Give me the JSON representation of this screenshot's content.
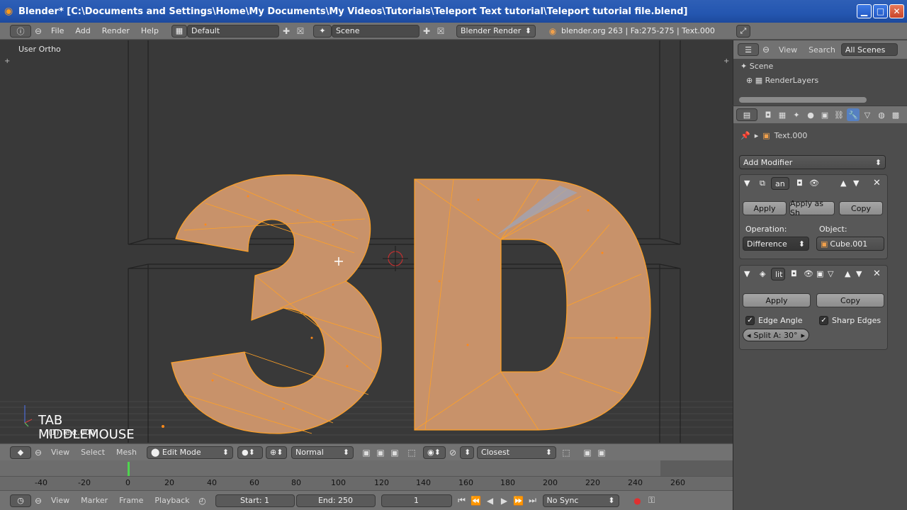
{
  "window": {
    "title": "Blender* [C:\\Documents and Settings\\Home\\My Documents\\My Videos\\Tutorials\\Teleport Text tutorial\\Teleport tutorial file.blend]",
    "minimize": "▁",
    "maximize": "□",
    "close": "✕"
  },
  "menubar": {
    "menus": [
      "File",
      "Add",
      "Render",
      "Help"
    ],
    "layout": "Default",
    "scene": "Scene",
    "engine": "Blender Render",
    "stats": "blender.org 263 | Fa:275-275 | Text.000"
  },
  "viewport": {
    "view_label": "User Ortho",
    "overlay_line1": "TAB",
    "overlay_line2": "MIDDLEMOUSE",
    "object_label": "(1) Text.000"
  },
  "header3d": {
    "menus": [
      "View",
      "Select",
      "Mesh"
    ],
    "mode": "Edit Mode",
    "orientation": "Normal",
    "snap": "Closest"
  },
  "timeline": {
    "ticks": [
      "-40",
      "-20",
      "0",
      "20",
      "40",
      "60",
      "80",
      "100",
      "120",
      "140",
      "160",
      "180",
      "200",
      "220",
      "240",
      "260"
    ]
  },
  "bottombar": {
    "menus": [
      "View",
      "Marker",
      "Frame",
      "Playback"
    ],
    "start": "Start: 1",
    "end": "End: 250",
    "current": "1",
    "sync": "No Sync"
  },
  "outliner": {
    "menus": [
      "View",
      "Search"
    ],
    "filter": "All Scenes",
    "items": [
      "Scene",
      "RenderLayers"
    ]
  },
  "properties": {
    "object": "Text.000",
    "add_modifier": "Add Modifier",
    "mod1": {
      "name": "an",
      "apply": "Apply",
      "apply_shape": "Apply as Sh",
      "copy": "Copy",
      "operation_label": "Operation:",
      "operation": "Difference",
      "object_label": "Object:",
      "object": "Cube.001"
    },
    "mod2": {
      "name": "lit",
      "apply": "Apply",
      "copy": "Copy",
      "edge_angle": "Edge Angle",
      "sharp_edges": "Sharp Edges",
      "split": "Split A: 30°"
    }
  },
  "colors": {
    "accent": "#f0a04b",
    "mesh": "#c8926a",
    "wire": "#ffa126"
  }
}
